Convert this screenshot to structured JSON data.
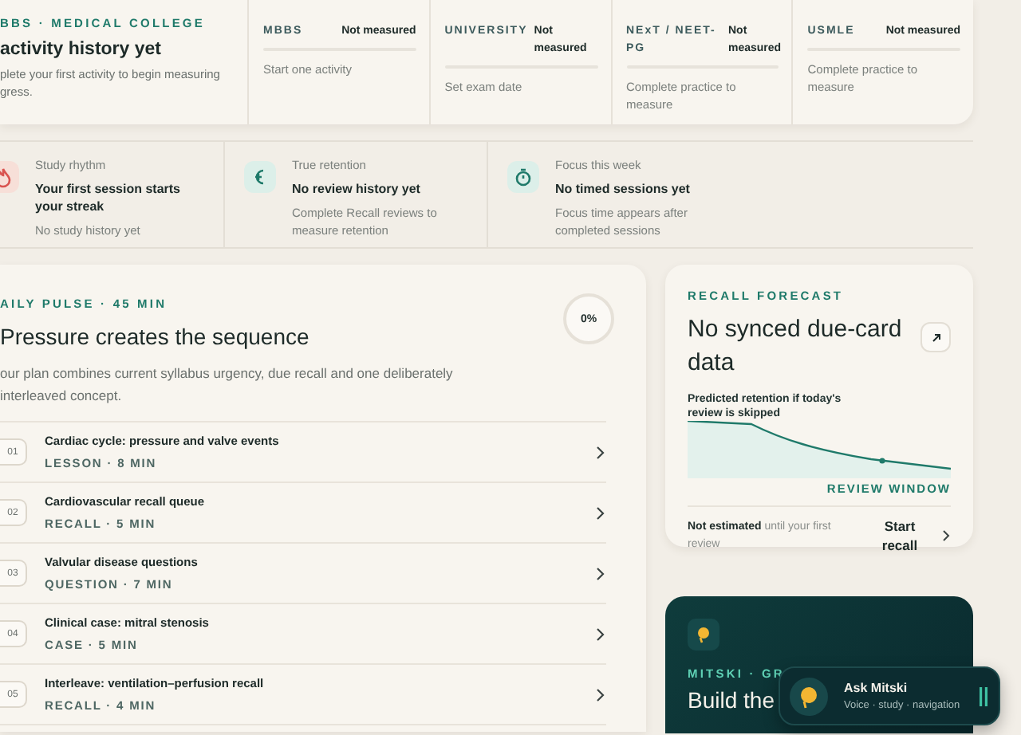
{
  "overview": {
    "eyebrow": "BBS · MEDICAL COLLEGE",
    "title": "activity history yet",
    "body_lines": [
      "plete your first activity to begin measuring",
      "gress."
    ]
  },
  "exams": [
    {
      "name": "MBBS",
      "status": "Not measured",
      "level": 0,
      "note": "Start one activity"
    },
    {
      "name": "UNIVERSITY",
      "status": "Not measured",
      "level": 0,
      "note": "Set exam date"
    },
    {
      "name": "NExT / NEET-PG",
      "status": "Not measured",
      "level": 0,
      "note": "Complete practice to measure"
    },
    {
      "name": "USMLE",
      "status": "Not measured",
      "level": 0,
      "note": "Complete practice to measure"
    }
  ],
  "stats": [
    {
      "kind": "streak",
      "label": "Study rhythm",
      "title": "Your first session starts your streak",
      "note": "No study history yet"
    },
    {
      "kind": "retention",
      "label": "True retention",
      "title": "No review history yet",
      "note": "Complete Recall reviews to measure retention"
    },
    {
      "kind": "focus",
      "label": "Focus this week",
      "title": "No timed sessions yet",
      "note": "Focus time appears after completed sessions"
    }
  ],
  "daily_pulse": {
    "eyebrow": "AILY PULSE · 45 MIN",
    "title": "Pressure creates the sequence",
    "body_lines": [
      "our plan combines current syllabus urgency, due recall and one deliberately",
      "interleaved concept."
    ],
    "progress": {
      "label": "0%"
    },
    "tasks": [
      {
        "number": "01",
        "title": "Cardiac cycle: pressure and valve events",
        "meta": "LESSON · 8 MIN"
      },
      {
        "number": "02",
        "title": "Cardiovascular recall queue",
        "meta": "RECALL · 5 MIN"
      },
      {
        "number": "03",
        "title": "Valvular disease questions",
        "meta": "QUESTION · 7 MIN"
      },
      {
        "number": "04",
        "title": "Clinical case: mitral stenosis",
        "meta": "CASE · 5 MIN"
      },
      {
        "number": "05",
        "title": "Interleave: ventilation–perfusion recall",
        "meta": "RECALL · 4 MIN"
      }
    ]
  },
  "recall_forecast": {
    "eyebrow": "RECALL FORECAST",
    "title": "No synced due-card data",
    "chart_caption": "Predicted retention if today's review is skipped",
    "window_label": "REVIEW WINDOW",
    "estimate": "**Not estimated** until your first review",
    "action": "Start recall"
  },
  "mitski": {
    "eyebrow": "MITSKI · GR",
    "title": "Build the"
  },
  "assistant": {
    "title": "Ask Mitski",
    "subtitle": "Voice · study · navigation"
  }
}
